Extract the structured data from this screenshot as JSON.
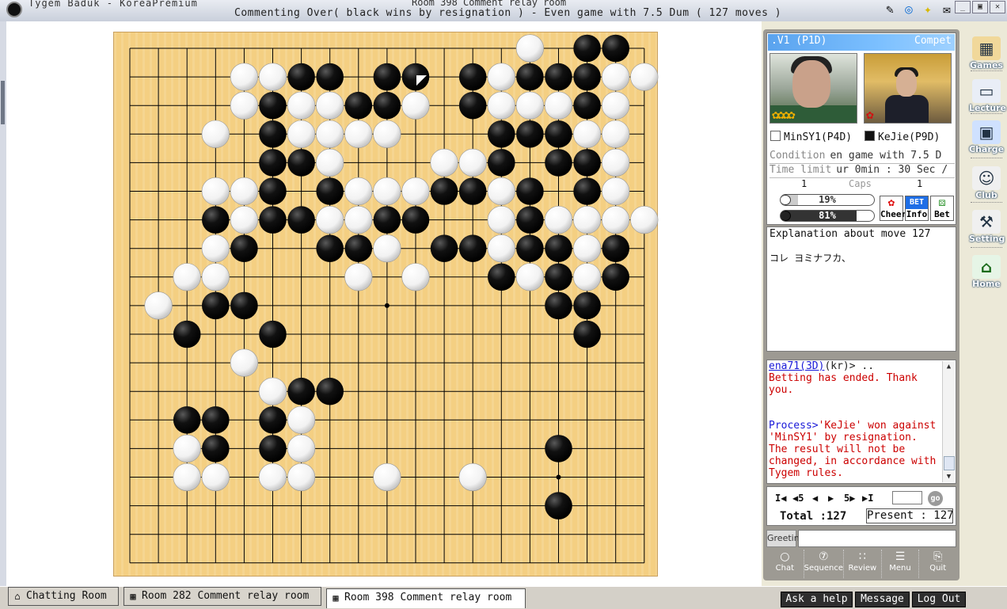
{
  "window": {
    "app_title": "Tygem Baduk - KoreaPremium",
    "room_title": "Room 398 Comment relay room",
    "game_status": "Commenting Over( black wins by resignation ) - Even game with 7.5 Dum  ( 127 moves )"
  },
  "titlebar_icons": [
    "paint-icon",
    "search-icon",
    "lightbulb-icon",
    "mail-icon"
  ],
  "window_buttons": [
    "_",
    "▣",
    "✕"
  ],
  "game": {
    "header_title": ".V1 (P1D)",
    "header_mode": "Compet",
    "white_player": "MinSY1(P4D)",
    "black_player": "KeJie(P9D)",
    "condition_label": "Condition",
    "condition_value": "en game with 7.5 D",
    "timelimit_label": "Time limit",
    "timelimit_value": "ur 0min : 30 Sec /",
    "caps_label": "Caps",
    "white_caps": "1",
    "black_caps": "1",
    "white_bet_percent": "19%",
    "white_bet_fraction": 0.19,
    "black_bet_percent": "81%",
    "black_bet_fraction": 0.81,
    "cheer_label": "Cheer",
    "info_label": "Info",
    "info_badge": "BET",
    "bet_label": "Bet"
  },
  "explanation": {
    "title": "Explanation about move 127",
    "body": "コレ ヨミナフカ、"
  },
  "chat": {
    "messages": [
      {
        "user": "ena71(3D)",
        "suffix": "(kr)> ..",
        "text": "Betting has ended. Thank you."
      },
      {
        "user": "Process>",
        "text": "'KeJie' won against 'MinSY1' by resignation. The result will not be changed, in accordance with Tygem rules."
      }
    ]
  },
  "navigation": {
    "first": "I◀",
    "back5": "◀5",
    "back": "◀",
    "forward": "▶",
    "forward5": "5▶",
    "last": "▶I",
    "go_label": "go",
    "total_text": "Total :127",
    "present_text": "Present : 127"
  },
  "greeting": {
    "label": "Greeting",
    "value": ""
  },
  "bottom_tools": [
    {
      "label": "Chat",
      "icon": "○"
    },
    {
      "label": "Sequence",
      "icon": "⑦"
    },
    {
      "label": "Review",
      "icon": "∷"
    },
    {
      "label": "Menu",
      "icon": "☰"
    },
    {
      "label": "Quit",
      "icon": "⎘"
    }
  ],
  "sidebar": [
    {
      "label": "Games",
      "icon": "▦"
    },
    {
      "label": "Lecture",
      "icon": "▭"
    },
    {
      "label": "Charge",
      "icon": "▣"
    },
    {
      "label": "Club",
      "icon": "☺"
    },
    {
      "label": "Setting",
      "icon": "⚒"
    },
    {
      "label": "Home",
      "icon": "⌂"
    }
  ],
  "taskbar": {
    "tabs": [
      {
        "label": "Chatting Room",
        "icon": "⌂"
      },
      {
        "label": "Room 282 Comment relay room",
        "icon": "▦"
      },
      {
        "label": "Room 398 Comment relay room",
        "icon": "▦"
      }
    ],
    "buttons": [
      "Ask a help",
      "Message",
      "Log Out"
    ]
  },
  "colors": {
    "board": "#f4cf82",
    "header_blue": "#5aa3ee",
    "chat_red": "#cc0000",
    "chat_blue": "#1919d8"
  },
  "board": {
    "size": 19,
    "last_move": "black",
    "stones": [
      {
        "c": "W",
        "x": 14,
        "y": 0
      },
      {
        "c": "B",
        "x": 16,
        "y": 0
      },
      {
        "c": "B",
        "x": 17,
        "y": 0
      },
      {
        "c": "W",
        "x": 4,
        "y": 1
      },
      {
        "c": "W",
        "x": 5,
        "y": 1
      },
      {
        "c": "B",
        "x": 6,
        "y": 1
      },
      {
        "c": "B",
        "x": 7,
        "y": 1
      },
      {
        "c": "B",
        "x": 9,
        "y": 1
      },
      {
        "c": "B",
        "x": 10,
        "y": 1,
        "last": true
      },
      {
        "c": "B",
        "x": 12,
        "y": 1
      },
      {
        "c": "W",
        "x": 13,
        "y": 1
      },
      {
        "c": "B",
        "x": 14,
        "y": 1
      },
      {
        "c": "B",
        "x": 15,
        "y": 1
      },
      {
        "c": "B",
        "x": 16,
        "y": 1
      },
      {
        "c": "W",
        "x": 17,
        "y": 1
      },
      {
        "c": "W",
        "x": 18,
        "y": 1
      },
      {
        "c": "W",
        "x": 4,
        "y": 2
      },
      {
        "c": "B",
        "x": 5,
        "y": 2
      },
      {
        "c": "W",
        "x": 6,
        "y": 2
      },
      {
        "c": "W",
        "x": 7,
        "y": 2
      },
      {
        "c": "B",
        "x": 8,
        "y": 2
      },
      {
        "c": "B",
        "x": 9,
        "y": 2
      },
      {
        "c": "W",
        "x": 10,
        "y": 2
      },
      {
        "c": "B",
        "x": 12,
        "y": 2
      },
      {
        "c": "W",
        "x": 13,
        "y": 2
      },
      {
        "c": "W",
        "x": 14,
        "y": 2
      },
      {
        "c": "W",
        "x": 15,
        "y": 2
      },
      {
        "c": "B",
        "x": 16,
        "y": 2
      },
      {
        "c": "W",
        "x": 17,
        "y": 2
      },
      {
        "c": "W",
        "x": 3,
        "y": 3
      },
      {
        "c": "B",
        "x": 5,
        "y": 3
      },
      {
        "c": "W",
        "x": 6,
        "y": 3
      },
      {
        "c": "W",
        "x": 7,
        "y": 3
      },
      {
        "c": "W",
        "x": 8,
        "y": 3
      },
      {
        "c": "W",
        "x": 9,
        "y": 3
      },
      {
        "c": "B",
        "x": 13,
        "y": 3
      },
      {
        "c": "B",
        "x": 14,
        "y": 3
      },
      {
        "c": "B",
        "x": 15,
        "y": 3
      },
      {
        "c": "W",
        "x": 16,
        "y": 3
      },
      {
        "c": "W",
        "x": 17,
        "y": 3
      },
      {
        "c": "B",
        "x": 5,
        "y": 4
      },
      {
        "c": "B",
        "x": 6,
        "y": 4
      },
      {
        "c": "W",
        "x": 7,
        "y": 4
      },
      {
        "c": "W",
        "x": 11,
        "y": 4
      },
      {
        "c": "W",
        "x": 12,
        "y": 4
      },
      {
        "c": "B",
        "x": 13,
        "y": 4
      },
      {
        "c": "B",
        "x": 15,
        "y": 4
      },
      {
        "c": "B",
        "x": 16,
        "y": 4
      },
      {
        "c": "W",
        "x": 17,
        "y": 4
      },
      {
        "c": "W",
        "x": 3,
        "y": 5
      },
      {
        "c": "W",
        "x": 4,
        "y": 5
      },
      {
        "c": "B",
        "x": 5,
        "y": 5
      },
      {
        "c": "B",
        "x": 7,
        "y": 5
      },
      {
        "c": "W",
        "x": 8,
        "y": 5
      },
      {
        "c": "W",
        "x": 9,
        "y": 5
      },
      {
        "c": "W",
        "x": 10,
        "y": 5
      },
      {
        "c": "B",
        "x": 11,
        "y": 5
      },
      {
        "c": "B",
        "x": 12,
        "y": 5
      },
      {
        "c": "W",
        "x": 13,
        "y": 5
      },
      {
        "c": "B",
        "x": 14,
        "y": 5
      },
      {
        "c": "B",
        "x": 16,
        "y": 5
      },
      {
        "c": "W",
        "x": 17,
        "y": 5
      },
      {
        "c": "B",
        "x": 3,
        "y": 6
      },
      {
        "c": "W",
        "x": 4,
        "y": 6
      },
      {
        "c": "B",
        "x": 5,
        "y": 6
      },
      {
        "c": "B",
        "x": 6,
        "y": 6
      },
      {
        "c": "W",
        "x": 7,
        "y": 6
      },
      {
        "c": "W",
        "x": 8,
        "y": 6
      },
      {
        "c": "B",
        "x": 9,
        "y": 6
      },
      {
        "c": "B",
        "x": 10,
        "y": 6
      },
      {
        "c": "W",
        "x": 13,
        "y": 6
      },
      {
        "c": "B",
        "x": 14,
        "y": 6
      },
      {
        "c": "W",
        "x": 15,
        "y": 6
      },
      {
        "c": "W",
        "x": 16,
        "y": 6
      },
      {
        "c": "W",
        "x": 17,
        "y": 6
      },
      {
        "c": "W",
        "x": 18,
        "y": 6
      },
      {
        "c": "W",
        "x": 3,
        "y": 7
      },
      {
        "c": "B",
        "x": 4,
        "y": 7
      },
      {
        "c": "B",
        "x": 7,
        "y": 7
      },
      {
        "c": "B",
        "x": 8,
        "y": 7
      },
      {
        "c": "W",
        "x": 9,
        "y": 7
      },
      {
        "c": "B",
        "x": 11,
        "y": 7
      },
      {
        "c": "B",
        "x": 12,
        "y": 7
      },
      {
        "c": "W",
        "x": 13,
        "y": 7
      },
      {
        "c": "B",
        "x": 14,
        "y": 7
      },
      {
        "c": "B",
        "x": 15,
        "y": 7
      },
      {
        "c": "W",
        "x": 16,
        "y": 7
      },
      {
        "c": "B",
        "x": 17,
        "y": 7
      },
      {
        "c": "W",
        "x": 2,
        "y": 8
      },
      {
        "c": "W",
        "x": 3,
        "y": 8
      },
      {
        "c": "W",
        "x": 8,
        "y": 8
      },
      {
        "c": "W",
        "x": 10,
        "y": 8
      },
      {
        "c": "B",
        "x": 13,
        "y": 8
      },
      {
        "c": "W",
        "x": 14,
        "y": 8
      },
      {
        "c": "B",
        "x": 15,
        "y": 8
      },
      {
        "c": "W",
        "x": 16,
        "y": 8
      },
      {
        "c": "B",
        "x": 17,
        "y": 8
      },
      {
        "c": "W",
        "x": 1,
        "y": 9
      },
      {
        "c": "B",
        "x": 3,
        "y": 9
      },
      {
        "c": "B",
        "x": 4,
        "y": 9
      },
      {
        "c": "B",
        "x": 15,
        "y": 9
      },
      {
        "c": "B",
        "x": 16,
        "y": 9
      },
      {
        "c": "B",
        "x": 2,
        "y": 10
      },
      {
        "c": "B",
        "x": 5,
        "y": 10
      },
      {
        "c": "B",
        "x": 16,
        "y": 10
      },
      {
        "c": "W",
        "x": 4,
        "y": 11
      },
      {
        "c": "W",
        "x": 5,
        "y": 12
      },
      {
        "c": "B",
        "x": 6,
        "y": 12
      },
      {
        "c": "B",
        "x": 7,
        "y": 12
      },
      {
        "c": "B",
        "x": 2,
        "y": 13
      },
      {
        "c": "B",
        "x": 3,
        "y": 13
      },
      {
        "c": "B",
        "x": 5,
        "y": 13
      },
      {
        "c": "W",
        "x": 6,
        "y": 13
      },
      {
        "c": "W",
        "x": 2,
        "y": 14
      },
      {
        "c": "B",
        "x": 3,
        "y": 14
      },
      {
        "c": "B",
        "x": 5,
        "y": 14
      },
      {
        "c": "W",
        "x": 6,
        "y": 14
      },
      {
        "c": "B",
        "x": 15,
        "y": 14
      },
      {
        "c": "W",
        "x": 2,
        "y": 15
      },
      {
        "c": "W",
        "x": 3,
        "y": 15
      },
      {
        "c": "W",
        "x": 5,
        "y": 15
      },
      {
        "c": "W",
        "x": 6,
        "y": 15
      },
      {
        "c": "W",
        "x": 9,
        "y": 15
      },
      {
        "c": "W",
        "x": 12,
        "y": 15
      },
      {
        "c": "B",
        "x": 15,
        "y": 16
      }
    ]
  }
}
